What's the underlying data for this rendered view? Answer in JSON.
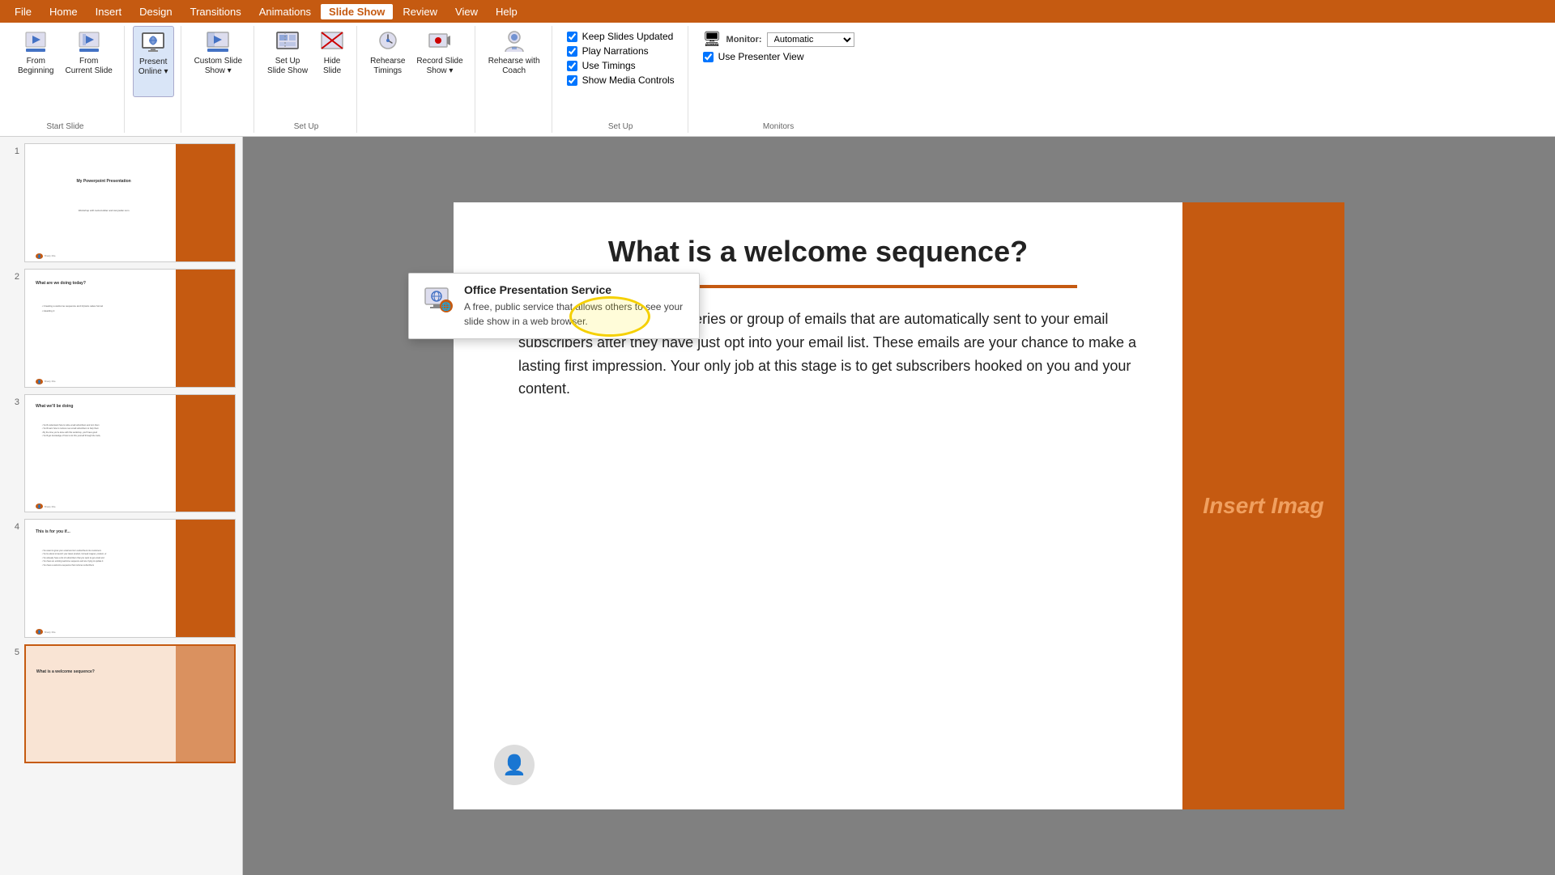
{
  "app": {
    "title": "PowerPoint"
  },
  "menu": {
    "items": [
      "File",
      "Home",
      "Insert",
      "Design",
      "Transitions",
      "Animations",
      "Slide Show",
      "Review",
      "View",
      "Help"
    ],
    "active": "Slide Show"
  },
  "ribbon": {
    "groups": [
      {
        "label": "Start Slide",
        "buttons": [
          {
            "id": "from-beginning",
            "label": "From\nBeginning",
            "icon": "play-icon"
          },
          {
            "id": "from-current",
            "label": "From\nCurrent Slide",
            "icon": "play-current-icon"
          }
        ]
      },
      {
        "label": "",
        "buttons": [
          {
            "id": "present-online",
            "label": "Present\nOnline",
            "icon": "present-online-icon",
            "has-dropdown": true
          }
        ]
      },
      {
        "label": "",
        "buttons": [
          {
            "id": "custom-slide-show",
            "label": "Custom Slide\nShow",
            "icon": "custom-show-icon",
            "has-dropdown": true
          }
        ]
      },
      {
        "label": "",
        "buttons": [
          {
            "id": "rehearse-timings",
            "label": "Rehearse\nTimings",
            "icon": "rehearse-icon"
          },
          {
            "id": "record-slide-show",
            "label": "Record Slide\nShow",
            "icon": "record-icon",
            "has-dropdown": true
          }
        ]
      },
      {
        "label": "",
        "buttons": [
          {
            "id": "rehearse-coach",
            "label": "Rehearse with\nCoach",
            "icon": "coach-icon"
          }
        ]
      },
      {
        "label": "",
        "buttons": [
          {
            "id": "setup-slideshow",
            "label": "Set Up\nSlide Show",
            "icon": "setup-icon"
          },
          {
            "id": "hide-slide",
            "label": "Hide\nSlide",
            "icon": "hide-icon"
          }
        ]
      }
    ],
    "checkboxes": {
      "keep_slides_updated": {
        "label": "Keep Slides Updated",
        "checked": true
      },
      "play_narrations": {
        "label": "Play Narrations",
        "checked": true
      },
      "use_timings": {
        "label": "Use Timings",
        "checked": true
      },
      "show_media_controls": {
        "label": "Show Media Controls",
        "checked": true
      }
    },
    "monitor": {
      "label": "Monitor:",
      "value": "Automatic",
      "use_presenter_view": {
        "label": "Use Presenter View",
        "checked": true
      },
      "group_label": "Monitors"
    },
    "setup_label": "Set Up"
  },
  "dropdown": {
    "title": "Office Presentation Service",
    "description": "A free, public service that allows others to see your slide show in a web browser."
  },
  "slides": [
    {
      "num": 1,
      "type": "title",
      "title": "My Powerpoint Presentation",
      "subtitle": "Workshop with tools-builder and storyteller.com"
    },
    {
      "num": 2,
      "type": "content",
      "title": "What are we doing today?"
    },
    {
      "num": 3,
      "type": "content",
      "title": "What we'll be doing"
    },
    {
      "num": 4,
      "type": "content",
      "title": "This is for you if..."
    },
    {
      "num": 5,
      "type": "active",
      "title": ""
    }
  ],
  "slide_content": {
    "title": "What is a welcome sequence?",
    "body": "A welcome sequence is a series or group of emails that are automatically sent to your email subscribers after they have just opt into your email list. These emails are your chance to make a lasting first impression. Your only job at this stage is to get subscribers hooked on you and your content.",
    "insert_image_label": "Insert Imag",
    "divider_color": "#c55a11"
  }
}
